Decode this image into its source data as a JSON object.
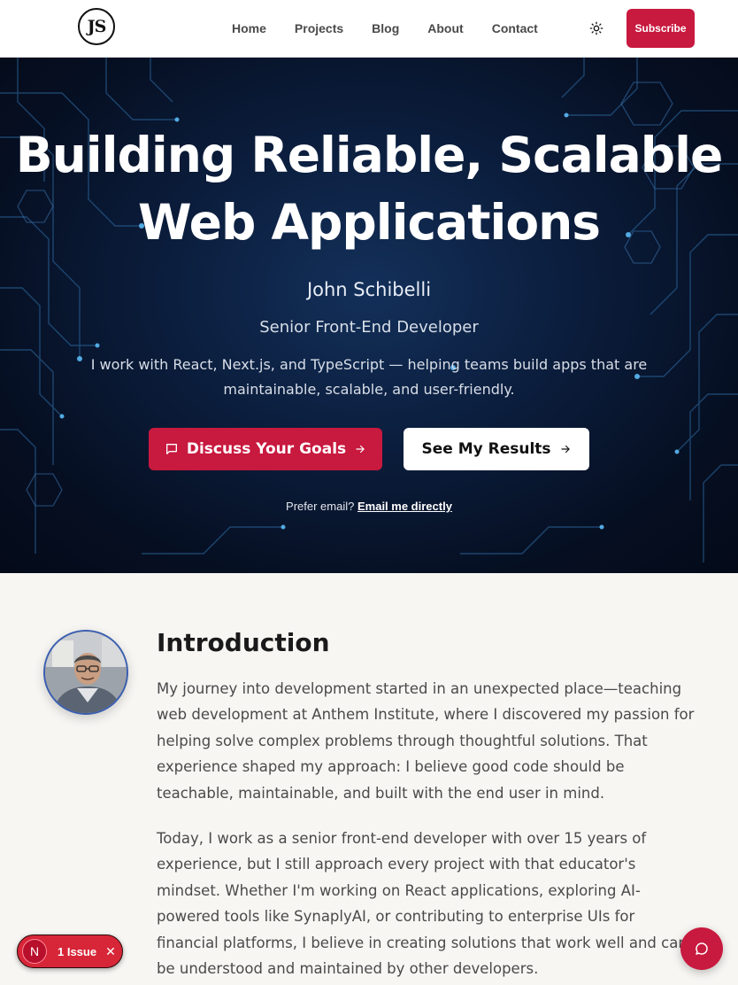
{
  "header": {
    "logo_text": "JS",
    "nav": [
      {
        "label": "Home"
      },
      {
        "label": "Projects"
      },
      {
        "label": "Blog"
      },
      {
        "label": "About"
      },
      {
        "label": "Contact"
      }
    ],
    "theme_icon": "sun-icon",
    "subscribe_label": "Subscribe"
  },
  "hero": {
    "title_line1": "Building Reliable, Scalable",
    "title_line2": "Web Applications",
    "name": "John Schibelli",
    "role": "Senior Front-End Developer",
    "description": "I work with React, Next.js, and TypeScript — helping teams build apps that are maintainable, scalable, and user-friendly.",
    "primary_cta": "Discuss Your Goals",
    "secondary_cta": "See My Results",
    "email_prompt": "Prefer email?",
    "email_link": "Email me directly"
  },
  "intro": {
    "title": "Introduction",
    "paragraph1": "My journey into development started in an unexpected place—teaching web development at Anthem Institute, where I discovered my passion for helping solve complex problems through thoughtful solutions. That experience shaped my approach: I believe good code should be teachable, maintainable, and built with the end user in mind.",
    "paragraph2": "Today, I work as a senior front-end developer with over 15 years of experience, but I still approach every project with that educator's mindset. Whether I'm working on React applications, exploring AI-powered tools like SynaplyAI, or contributing to enterprise UIs for financial platforms, I believe in creating solutions that work well and can be understood and maintained by other developers."
  },
  "floating": {
    "issues_badge": "N",
    "issues_label": "1 Issue",
    "close_icon": "close-icon",
    "chat_icon": "chat-icon"
  },
  "colors": {
    "accent": "#c8193f",
    "hero_bg": "#0b1d3c",
    "page_bg": "#f7f6f3"
  }
}
